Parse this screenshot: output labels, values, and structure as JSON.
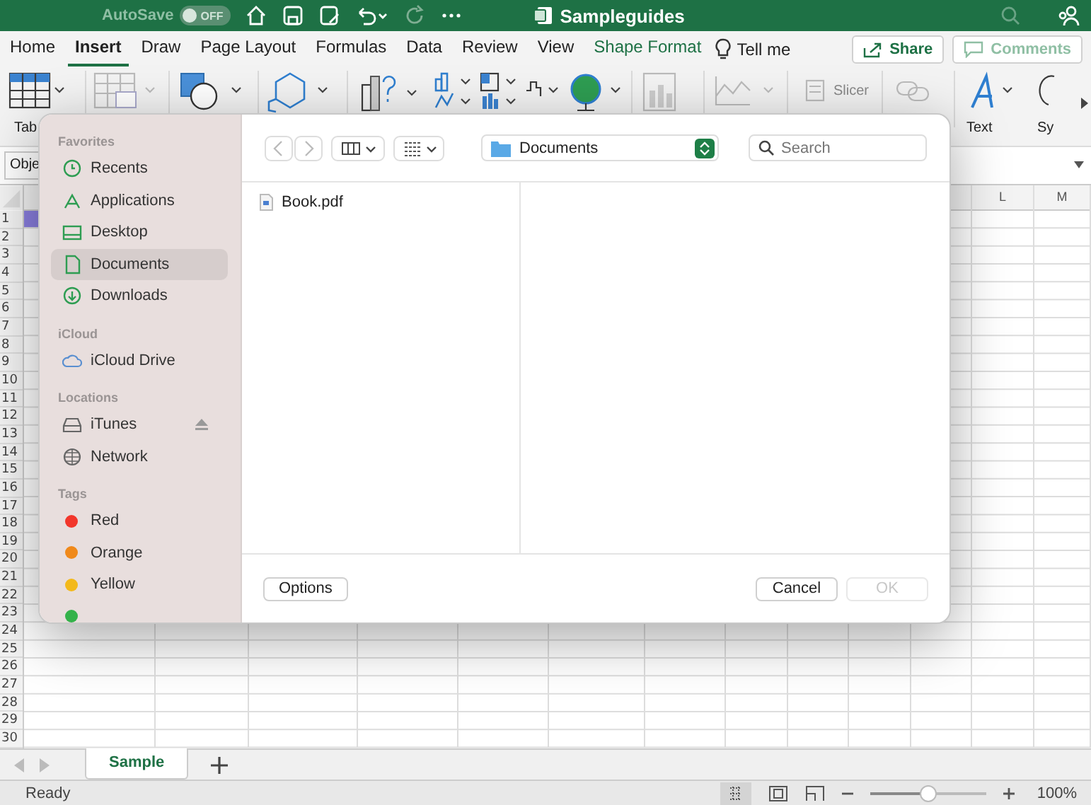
{
  "title_bar": {
    "autosave_label": "AutoSave",
    "autosave_toggle": {
      "on": false,
      "label": "OFF"
    },
    "title": "Sampleguides"
  },
  "ribbon_tabs": [
    {
      "label": "Home",
      "selected": false,
      "kind": "normal"
    },
    {
      "label": "Insert",
      "selected": true,
      "kind": "normal"
    },
    {
      "label": "Draw",
      "selected": false,
      "kind": "normal"
    },
    {
      "label": "Page Layout",
      "selected": false,
      "kind": "normal"
    },
    {
      "label": "Formulas",
      "selected": false,
      "kind": "normal"
    },
    {
      "label": "Data",
      "selected": false,
      "kind": "normal"
    },
    {
      "label": "Review",
      "selected": false,
      "kind": "normal"
    },
    {
      "label": "View",
      "selected": false,
      "kind": "normal"
    },
    {
      "label": "Shape Format",
      "selected": false,
      "kind": "contextual"
    }
  ],
  "tell_me": "Tell me",
  "share_button": "Share",
  "comments_button": "Comments",
  "ribbon_labels": [
    "Tab",
    "Slicer",
    "Text",
    "Sy"
  ],
  "formula_bar": {
    "name_box": "Obje"
  },
  "sheet": {
    "column_headers": [
      "L",
      "M"
    ],
    "row_numbers": [
      "1",
      "2",
      "3",
      "4",
      "5",
      "6",
      "7",
      "8",
      "9",
      "10",
      "11",
      "12",
      "13",
      "14",
      "15",
      "16",
      "17",
      "18",
      "19",
      "20",
      "21",
      "22",
      "23",
      "24",
      "25",
      "26",
      "27",
      "28",
      "29",
      "30"
    ]
  },
  "sheet_tabs": [
    {
      "label": "Sample",
      "selected": true
    }
  ],
  "status_bar": {
    "text": "Ready",
    "zoom_slider": {
      "level": 0.5
    },
    "zoom": "100%"
  },
  "dialog": {
    "sidebar": [
      {
        "heading": "Favorites",
        "items": [
          {
            "label": "Recents",
            "kind": "place",
            "selected": false
          },
          {
            "label": "Applications",
            "kind": "place",
            "selected": false
          },
          {
            "label": "Desktop",
            "kind": "place",
            "selected": false
          },
          {
            "label": "Documents",
            "kind": "place",
            "selected": true
          },
          {
            "label": "Downloads",
            "kind": "place",
            "selected": false
          }
        ]
      },
      {
        "heading": "iCloud",
        "items": [
          {
            "label": "iCloud Drive",
            "kind": "place",
            "selected": false
          }
        ]
      },
      {
        "heading": "Locations",
        "items": [
          {
            "label": "iTunes",
            "kind": "place",
            "selected": false,
            "eject": true
          },
          {
            "label": "Network",
            "kind": "place",
            "selected": false
          }
        ]
      },
      {
        "heading": "Tags",
        "items": [
          {
            "label": "Red",
            "kind": "tag",
            "color": "#f2362b",
            "selected": false
          },
          {
            "label": "Orange",
            "kind": "tag",
            "color": "#f0891a",
            "selected": false
          },
          {
            "label": "Yellow",
            "kind": "tag",
            "color": "#f3b91a",
            "selected": false
          },
          {
            "kind": "tag",
            "color": "#34b24a",
            "selected": false
          }
        ]
      }
    ],
    "location": "Documents",
    "search_placeholder": "Search",
    "files": [
      {
        "name": "Book.pdf",
        "selected": false
      }
    ],
    "options_button": "Options",
    "cancel_button": "Cancel",
    "ok_button": {
      "label": "OK",
      "disabled": true
    }
  }
}
